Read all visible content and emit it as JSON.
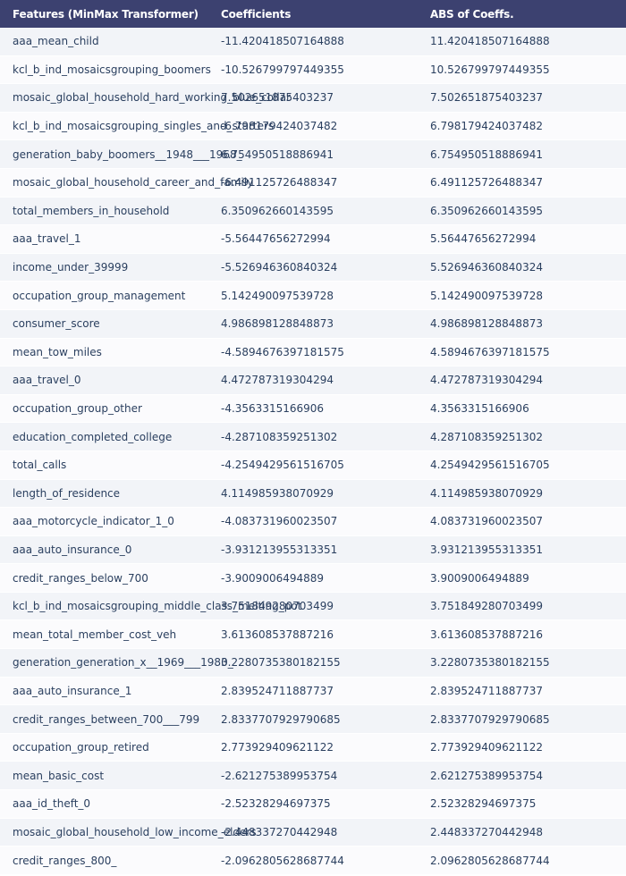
{
  "headers": {
    "feature": "Features (MinMax Transformer)",
    "coef": "Coefficients",
    "abs": "ABS of Coeffs."
  },
  "rows": [
    {
      "feature": "aaa_mean_child",
      "coef": "-11.420418507164888",
      "abs": "11.420418507164888"
    },
    {
      "feature": "kcl_b_ind_mosaicsgrouping_boomers",
      "coef": "-10.526799797449355",
      "abs": "10.526799797449355"
    },
    {
      "feature": "mosaic_global_household_hard_working_blue_collar",
      "coef": "7.502651875403237",
      "abs": "7.502651875403237"
    },
    {
      "feature": "kcl_b_ind_mosaicsgrouping_singles_and_starters",
      "coef": "-6.798179424037482",
      "abs": "6.798179424037482"
    },
    {
      "feature": "generation_baby_boomers__1948___1968_",
      "coef": "6.754950518886941",
      "abs": "6.754950518886941"
    },
    {
      "feature": "mosaic_global_household_career_and_family",
      "coef": "-6.491125726488347",
      "abs": "6.491125726488347"
    },
    {
      "feature": "total_members_in_household",
      "coef": "6.350962660143595",
      "abs": "6.350962660143595"
    },
    {
      "feature": "aaa_travel_1",
      "coef": "-5.56447656272994",
      "abs": "5.56447656272994"
    },
    {
      "feature": "income_under_39999",
      "coef": "-5.526946360840324",
      "abs": "5.526946360840324"
    },
    {
      "feature": "occupation_group_management",
      "coef": "5.142490097539728",
      "abs": "5.142490097539728"
    },
    {
      "feature": "consumer_score",
      "coef": "4.986898128848873",
      "abs": "4.986898128848873"
    },
    {
      "feature": "mean_tow_miles",
      "coef": "-4.5894676397181575",
      "abs": "4.5894676397181575"
    },
    {
      "feature": "aaa_travel_0",
      "coef": "4.472787319304294",
      "abs": "4.472787319304294"
    },
    {
      "feature": "occupation_group_other",
      "coef": "-4.3563315166906",
      "abs": "4.3563315166906"
    },
    {
      "feature": "education_completed_college",
      "coef": "-4.287108359251302",
      "abs": "4.287108359251302"
    },
    {
      "feature": "total_calls",
      "coef": "-4.2549429561516705",
      "abs": "4.2549429561516705"
    },
    {
      "feature": "length_of_residence",
      "coef": "4.114985938070929",
      "abs": "4.114985938070929"
    },
    {
      "feature": "aaa_motorcycle_indicator_1_0",
      "coef": "-4.083731960023507",
      "abs": "4.083731960023507"
    },
    {
      "feature": "aaa_auto_insurance_0",
      "coef": "-3.931213955313351",
      "abs": "3.931213955313351"
    },
    {
      "feature": "credit_ranges_below_700",
      "coef": "-3.9009006494889",
      "abs": "3.9009006494889"
    },
    {
      "feature": "kcl_b_ind_mosaicsgrouping_middle_class_melting_pot",
      "coef": "3.751849280703499",
      "abs": "3.751849280703499"
    },
    {
      "feature": "mean_total_member_cost_veh",
      "coef": "3.613608537887216",
      "abs": "3.613608537887216"
    },
    {
      "feature": "generation_generation_x__1969___1980_",
      "coef": "3.2280735380182155",
      "abs": "3.2280735380182155"
    },
    {
      "feature": "aaa_auto_insurance_1",
      "coef": "2.839524711887737",
      "abs": "2.839524711887737"
    },
    {
      "feature": "credit_ranges_between_700___799",
      "coef": "2.8337707929790685",
      "abs": "2.8337707929790685"
    },
    {
      "feature": "occupation_group_retired",
      "coef": "2.773929409621122",
      "abs": "2.773929409621122"
    },
    {
      "feature": "mean_basic_cost",
      "coef": "-2.621275389953754",
      "abs": "2.621275389953754"
    },
    {
      "feature": "aaa_id_theft_0",
      "coef": "-2.52328294697375",
      "abs": "2.52328294697375"
    },
    {
      "feature": "mosaic_global_household_low_income_elders",
      "coef": "-2.448337270442948",
      "abs": "2.448337270442948"
    },
    {
      "feature": "credit_ranges_800_",
      "coef": "-2.0962805628687744",
      "abs": "2.0962805628687744"
    }
  ]
}
